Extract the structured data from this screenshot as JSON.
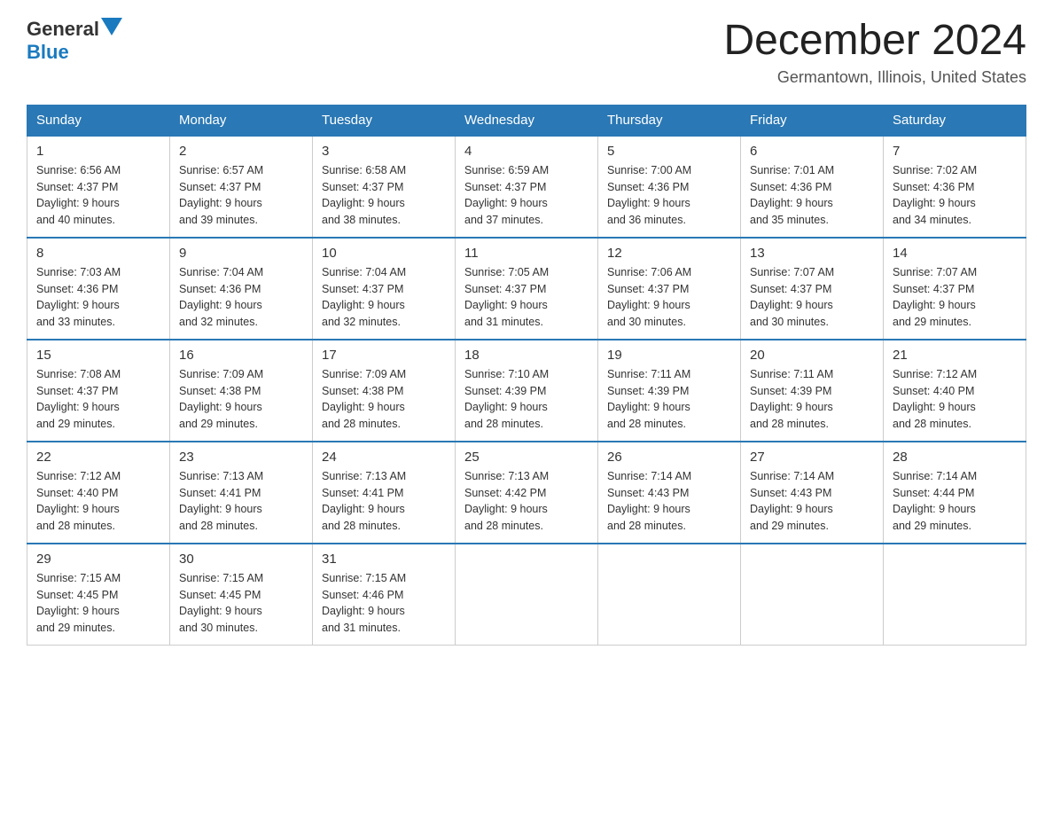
{
  "logo": {
    "text_general": "General",
    "text_blue": "Blue"
  },
  "title": "December 2024",
  "location": "Germantown, Illinois, United States",
  "days_of_week": [
    "Sunday",
    "Monday",
    "Tuesday",
    "Wednesday",
    "Thursday",
    "Friday",
    "Saturday"
  ],
  "weeks": [
    [
      {
        "day": "1",
        "sunrise": "6:56 AM",
        "sunset": "4:37 PM",
        "daylight": "9 hours and 40 minutes."
      },
      {
        "day": "2",
        "sunrise": "6:57 AM",
        "sunset": "4:37 PM",
        "daylight": "9 hours and 39 minutes."
      },
      {
        "day": "3",
        "sunrise": "6:58 AM",
        "sunset": "4:37 PM",
        "daylight": "9 hours and 38 minutes."
      },
      {
        "day": "4",
        "sunrise": "6:59 AM",
        "sunset": "4:37 PM",
        "daylight": "9 hours and 37 minutes."
      },
      {
        "day": "5",
        "sunrise": "7:00 AM",
        "sunset": "4:36 PM",
        "daylight": "9 hours and 36 minutes."
      },
      {
        "day": "6",
        "sunrise": "7:01 AM",
        "sunset": "4:36 PM",
        "daylight": "9 hours and 35 minutes."
      },
      {
        "day": "7",
        "sunrise": "7:02 AM",
        "sunset": "4:36 PM",
        "daylight": "9 hours and 34 minutes."
      }
    ],
    [
      {
        "day": "8",
        "sunrise": "7:03 AM",
        "sunset": "4:36 PM",
        "daylight": "9 hours and 33 minutes."
      },
      {
        "day": "9",
        "sunrise": "7:04 AM",
        "sunset": "4:36 PM",
        "daylight": "9 hours and 32 minutes."
      },
      {
        "day": "10",
        "sunrise": "7:04 AM",
        "sunset": "4:37 PM",
        "daylight": "9 hours and 32 minutes."
      },
      {
        "day": "11",
        "sunrise": "7:05 AM",
        "sunset": "4:37 PM",
        "daylight": "9 hours and 31 minutes."
      },
      {
        "day": "12",
        "sunrise": "7:06 AM",
        "sunset": "4:37 PM",
        "daylight": "9 hours and 30 minutes."
      },
      {
        "day": "13",
        "sunrise": "7:07 AM",
        "sunset": "4:37 PM",
        "daylight": "9 hours and 30 minutes."
      },
      {
        "day": "14",
        "sunrise": "7:07 AM",
        "sunset": "4:37 PM",
        "daylight": "9 hours and 29 minutes."
      }
    ],
    [
      {
        "day": "15",
        "sunrise": "7:08 AM",
        "sunset": "4:37 PM",
        "daylight": "9 hours and 29 minutes."
      },
      {
        "day": "16",
        "sunrise": "7:09 AM",
        "sunset": "4:38 PM",
        "daylight": "9 hours and 29 minutes."
      },
      {
        "day": "17",
        "sunrise": "7:09 AM",
        "sunset": "4:38 PM",
        "daylight": "9 hours and 28 minutes."
      },
      {
        "day": "18",
        "sunrise": "7:10 AM",
        "sunset": "4:39 PM",
        "daylight": "9 hours and 28 minutes."
      },
      {
        "day": "19",
        "sunrise": "7:11 AM",
        "sunset": "4:39 PM",
        "daylight": "9 hours and 28 minutes."
      },
      {
        "day": "20",
        "sunrise": "7:11 AM",
        "sunset": "4:39 PM",
        "daylight": "9 hours and 28 minutes."
      },
      {
        "day": "21",
        "sunrise": "7:12 AM",
        "sunset": "4:40 PM",
        "daylight": "9 hours and 28 minutes."
      }
    ],
    [
      {
        "day": "22",
        "sunrise": "7:12 AM",
        "sunset": "4:40 PM",
        "daylight": "9 hours and 28 minutes."
      },
      {
        "day": "23",
        "sunrise": "7:13 AM",
        "sunset": "4:41 PM",
        "daylight": "9 hours and 28 minutes."
      },
      {
        "day": "24",
        "sunrise": "7:13 AM",
        "sunset": "4:41 PM",
        "daylight": "9 hours and 28 minutes."
      },
      {
        "day": "25",
        "sunrise": "7:13 AM",
        "sunset": "4:42 PM",
        "daylight": "9 hours and 28 minutes."
      },
      {
        "day": "26",
        "sunrise": "7:14 AM",
        "sunset": "4:43 PM",
        "daylight": "9 hours and 28 minutes."
      },
      {
        "day": "27",
        "sunrise": "7:14 AM",
        "sunset": "4:43 PM",
        "daylight": "9 hours and 29 minutes."
      },
      {
        "day": "28",
        "sunrise": "7:14 AM",
        "sunset": "4:44 PM",
        "daylight": "9 hours and 29 minutes."
      }
    ],
    [
      {
        "day": "29",
        "sunrise": "7:15 AM",
        "sunset": "4:45 PM",
        "daylight": "9 hours and 29 minutes."
      },
      {
        "day": "30",
        "sunrise": "7:15 AM",
        "sunset": "4:45 PM",
        "daylight": "9 hours and 30 minutes."
      },
      {
        "day": "31",
        "sunrise": "7:15 AM",
        "sunset": "4:46 PM",
        "daylight": "9 hours and 31 minutes."
      },
      null,
      null,
      null,
      null
    ]
  ],
  "sunrise_label": "Sunrise:",
  "sunset_label": "Sunset:",
  "daylight_label": "Daylight:"
}
